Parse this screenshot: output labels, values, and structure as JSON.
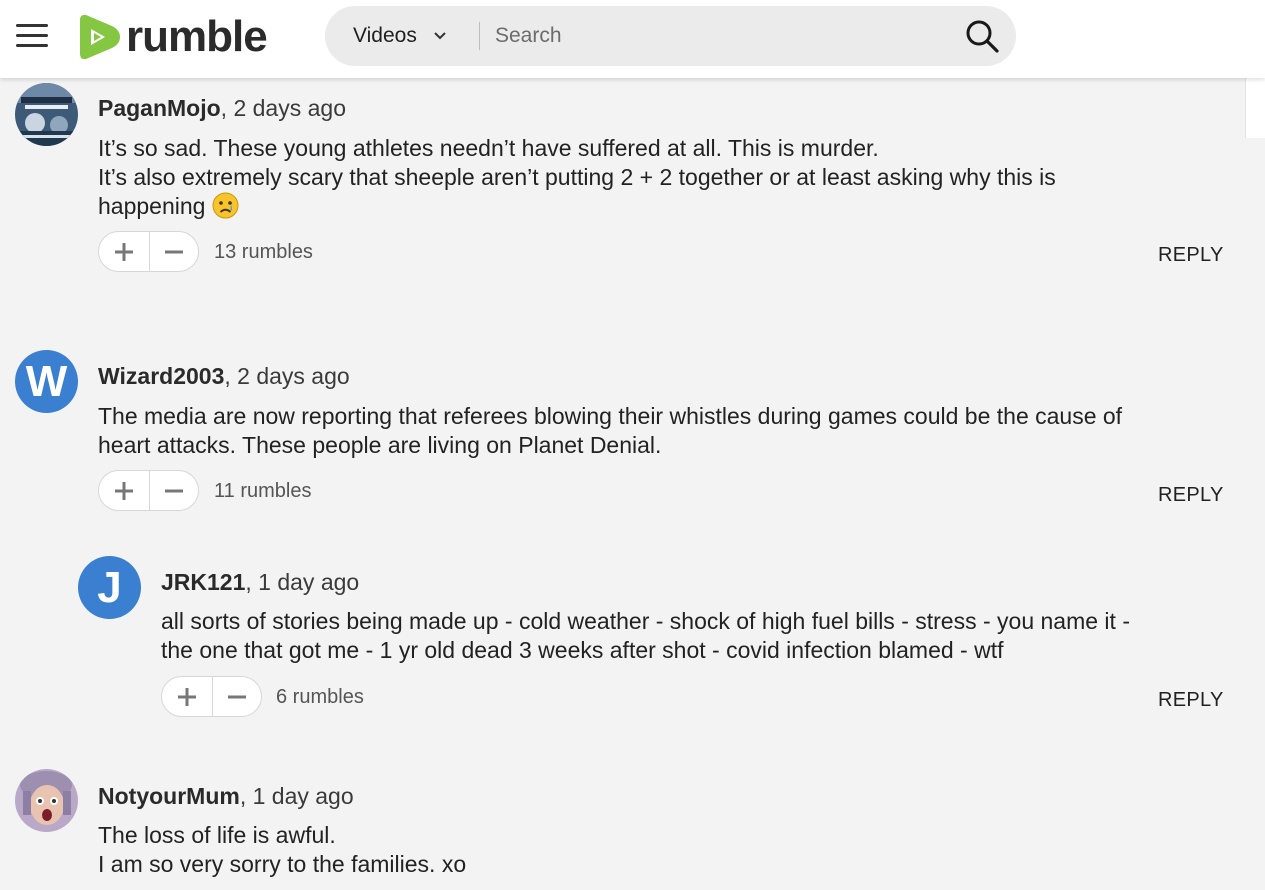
{
  "header": {
    "logo_text": "rumble",
    "search_category": "Videos",
    "search_placeholder": "Search",
    "brand_color": "#85c742"
  },
  "comments": [
    {
      "username": "PaganMojo",
      "time": " 2 days ago",
      "lines": [
        "It’s so sad. These young athletes needn’t have suffered at all. This is murder.",
        "It’s also extremely scary that sheeple aren’t putting 2 + 2 together or at least asking why this is",
        "happening"
      ],
      "emoji": "crying-face",
      "rumbles": "13 rumbles",
      "reply": "REPLY"
    },
    {
      "username": "Wizard2003",
      "time": " 2 days ago",
      "avatar_letter": "W",
      "lines": [
        "The media are now reporting that referees blowing their whistles during games could be the cause of",
        "heart attacks. These people are living on Planet Denial."
      ],
      "rumbles": "11 rumbles",
      "reply": "REPLY"
    },
    {
      "username": "JRK121",
      "time": " 1 day ago",
      "avatar_letter": "J",
      "lines": [
        "all sorts of stories being made up - cold weather - shock of high fuel bills - stress - you name it -",
        "the one that got me - 1 yr old dead 3 weeks after shot - covid infection blamed - wtf"
      ],
      "rumbles": "6 rumbles",
      "reply": "REPLY"
    },
    {
      "username": "NotyourMum",
      "time": " 1 day ago",
      "lines": [
        "The loss of life is awful.",
        "I am so very sorry to the families. xo"
      ]
    }
  ],
  "comma": ","
}
